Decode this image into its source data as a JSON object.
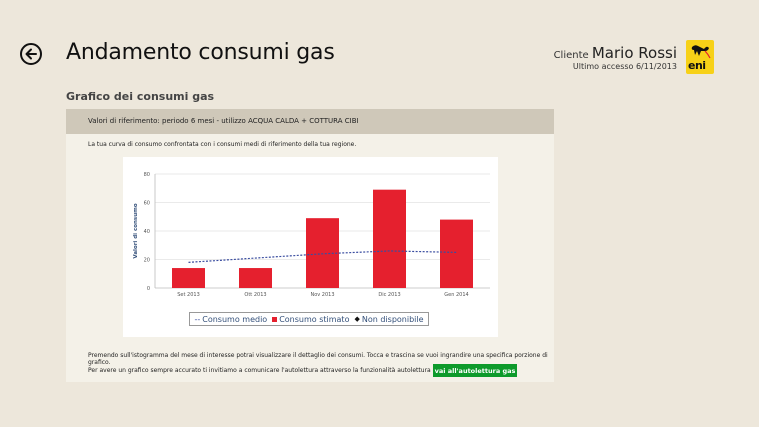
{
  "header": {
    "title": "Andamento consumi gas",
    "customer_label": "Cliente",
    "customer_name": "Mario Rossi",
    "last_access": "Ultimo accesso 6/11/2013",
    "logo_text": "eni"
  },
  "section": {
    "title": "Grafico dei consumi gas"
  },
  "panel": {
    "header": "Valori di riferimento: periodo 6 mesi - utilizzo ACQUA CALDA + COTTURA CIBI",
    "description": "La tua curva di consumo confrontata con i consumi medi di riferimento della tua regione.",
    "footer_line1": "Premendo sull'istogramma del mese di interesse potrai visualizzare il dettaglio dei consumi. Tocca e trascina se vuoi ingrandire una specifica porzione di grafico.",
    "footer_line2": "Per avere un grafico sempre accurato ti invitiamo a comunicare l'autolettura attraverso la funzionalità autolettura gas.",
    "cta_label": "vai all'autolettura gas"
  },
  "legend": {
    "medio": "Consumo medio",
    "stimato": "Consumo stimato",
    "non_disponibile": "Non disponibile"
  },
  "colors": {
    "bar": "#e5202e",
    "average_line": "#3a4da0",
    "accent_button": "#0d9a2b",
    "logo": "#f7d117"
  },
  "icons": {
    "back": "arrow-left-circle-icon",
    "logo": "eni-dog-logo"
  },
  "chart_data": {
    "type": "bar",
    "categories": [
      "Set 2013",
      "Ott 2013",
      "Nov 2013",
      "Dic 2013",
      "Gen 2014"
    ],
    "series": [
      {
        "name": "Consumo stimato",
        "type": "bar",
        "values": [
          14,
          14,
          49,
          69,
          48
        ]
      },
      {
        "name": "Consumo medio",
        "type": "line",
        "values": [
          18,
          21,
          24,
          26,
          25
        ]
      }
    ],
    "ylabel": "Valori di consumo",
    "xlabel": "",
    "ylim": [
      0,
      80
    ],
    "yticks": [
      0,
      20,
      40,
      60,
      80
    ],
    "grid": true,
    "legend_position": "bottom"
  }
}
